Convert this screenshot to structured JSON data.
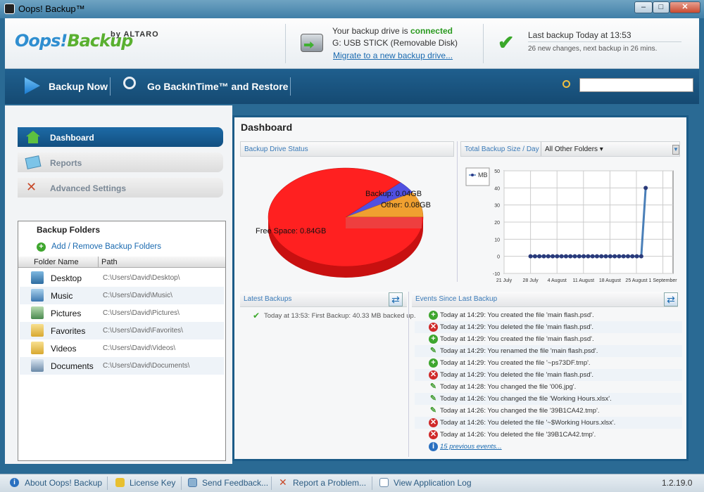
{
  "window": {
    "title": "Oops! Backup™"
  },
  "header": {
    "logo_text_1": "Oops!",
    "logo_text_2": "Backup",
    "logo_by": "by ALTARO",
    "drive_status_prefix": "Your backup drive is",
    "drive_status_value": "connected",
    "drive_name": "G: USB STICK (Removable Disk)",
    "migrate_link": "Migrate to a new backup drive...",
    "last_backup": "Last backup Today at 13:53",
    "last_backup_detail": "26 new changes, next backup in 26 mins."
  },
  "toolbar": {
    "backup_now": "Backup Now",
    "backintime": "Go BackInTime™ and Restore",
    "search_placeholder": ""
  },
  "nav": [
    {
      "label": "Dashboard"
    },
    {
      "label": "Reports"
    },
    {
      "label": "Advanced Settings"
    }
  ],
  "folders": {
    "title": "Backup Folders",
    "add_remove": "Add / Remove Backup Folders",
    "col_name": "Folder Name",
    "col_path": "Path",
    "rows": [
      {
        "name": "Desktop",
        "path": "C:\\Users\\David\\Desktop\\"
      },
      {
        "name": "Music",
        "path": "C:\\Users\\David\\Music\\"
      },
      {
        "name": "Pictures",
        "path": "C:\\Users\\David\\Pictures\\"
      },
      {
        "name": "Favorites",
        "path": "C:\\Users\\David\\Favorites\\"
      },
      {
        "name": "Videos",
        "path": "C:\\Users\\David\\Videos\\"
      },
      {
        "name": "Documents",
        "path": "C:\\Users\\David\\Documents\\"
      }
    ]
  },
  "dashboard": {
    "title": "Dashboard",
    "drive_status_panel": "Backup Drive Status",
    "size_panel": "Total Backup Size / Day",
    "folder_filter": "All Other Folders",
    "latest_panel": "Latest Backups",
    "events_panel": "Events Since Last Backup",
    "latest_entry": "Today at 13:53: First Backup: 40.33 MB backed up.",
    "previous_events": "15 previous events...",
    "pie_labels": {
      "free": "Free Space: 0.84GB",
      "backup": "Backup: 0.04GB",
      "other": "Other: 0.08GB"
    },
    "legend_mb": "MB",
    "events": [
      {
        "type": "add",
        "text": "Today at 14:29: You created the file 'main flash.psd'."
      },
      {
        "type": "del",
        "text": "Today at 14:29: You deleted the file 'main flash.psd'."
      },
      {
        "type": "add",
        "text": "Today at 14:29: You created the file 'main flash.psd'."
      },
      {
        "type": "edit",
        "text": "Today at 14:29: You renamed the file 'main flash.psd'."
      },
      {
        "type": "add",
        "text": "Today at 14:29: You created the file '~ps73DF.tmp'."
      },
      {
        "type": "del",
        "text": "Today at 14:29: You deleted the file 'main flash.psd'."
      },
      {
        "type": "edit",
        "text": "Today at 14:28: You changed the file '006.jpg'."
      },
      {
        "type": "edit",
        "text": "Today at 14:26: You changed the file 'Working Hours.xlsx'."
      },
      {
        "type": "edit",
        "text": "Today at 14:26: You changed the file '39B1CA42.tmp'."
      },
      {
        "type": "del",
        "text": "Today at 14:26: You deleted the file '~$Working Hours.xlsx'."
      },
      {
        "type": "del",
        "text": "Today at 14:26: You deleted the file '39B1CA42.tmp'."
      }
    ]
  },
  "chart_data": [
    {
      "type": "pie",
      "categories": [
        "Free Space",
        "Backup",
        "Other"
      ],
      "values": [
        0.84,
        0.04,
        0.08
      ],
      "unit": "GB",
      "colors": [
        "#ff2020",
        "#5050e0",
        "#f0a030"
      ]
    },
    {
      "type": "line",
      "series": [
        {
          "name": "MB",
          "values": [
            0,
            0,
            0,
            0,
            0,
            0,
            0,
            0,
            0,
            0,
            0,
            0,
            0,
            0,
            0,
            0,
            0,
            0,
            0,
            0,
            0,
            0,
            0,
            0,
            0,
            0,
            40
          ]
        }
      ],
      "x_tick_labels": [
        "21 July",
        "28 July",
        "4 August",
        "11 August",
        "18 August",
        "25 August",
        "1 September"
      ],
      "ylim": [
        -10,
        50
      ],
      "yticks": [
        -10,
        0,
        10,
        20,
        30,
        40,
        50
      ],
      "grid": true,
      "legend_position": "top-left",
      "color": "#4a7fb8"
    }
  ],
  "statusbar": {
    "about": "About Oops! Backup",
    "license": "License Key",
    "feedback": "Send Feedback...",
    "report": "Report a Problem...",
    "log": "View Application Log",
    "version": "1.2.19.0"
  }
}
